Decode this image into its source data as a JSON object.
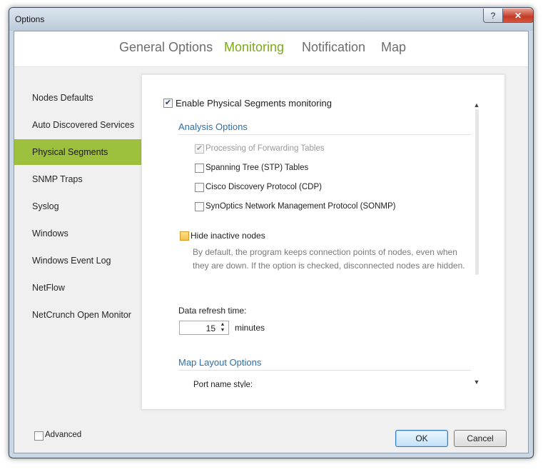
{
  "window": {
    "title": "Options",
    "help_label": "?",
    "close_label": "✕"
  },
  "tabs": [
    {
      "label": "General Options"
    },
    {
      "label": "Monitoring"
    },
    {
      "label": "Notification"
    },
    {
      "label": "Map"
    }
  ],
  "sidebar": {
    "items": [
      {
        "label": "Nodes Defaults"
      },
      {
        "label": "Auto Discovered Services"
      },
      {
        "label": "Physical Segments"
      },
      {
        "label": "SNMP Traps"
      },
      {
        "label": "Syslog"
      },
      {
        "label": "Windows"
      },
      {
        "label": "Windows Event Log"
      },
      {
        "label": "NetFlow"
      },
      {
        "label": "NetCrunch Open Monitor"
      }
    ],
    "active_index": 2
  },
  "panel": {
    "enable_label": "Enable Physical Segments monitoring",
    "analysis_header": "Analysis Options",
    "options": [
      {
        "label": "Processing of Forwarding Tables",
        "checked": true,
        "disabled": true
      },
      {
        "label": "Spanning Tree (STP) Tables",
        "checked": false,
        "disabled": false
      },
      {
        "label": "Cisco Discovery Protocol (CDP)",
        "checked": false,
        "disabled": false
      },
      {
        "label": "SynOptics Network Management Protocol (SONMP)",
        "checked": false,
        "disabled": false
      }
    ],
    "hide_inactive_label": "Hide inactive nodes",
    "hide_inactive_desc": "By default, the program keeps connection points of nodes, even when they are down. If the option is checked, disconnected nodes are hidden.",
    "refresh_label": "Data refresh time:",
    "refresh_value": "15",
    "refresh_unit": "minutes",
    "map_layout_header": "Map Layout Options",
    "port_name_label": "Port name style:"
  },
  "footer": {
    "advanced_label": "Advanced",
    "ok_label": "OK",
    "cancel_label": "Cancel"
  },
  "colors": {
    "accent_green": "#9dc13c",
    "active_tab": "#7aaa1c",
    "section_blue": "#2a6fb0"
  }
}
